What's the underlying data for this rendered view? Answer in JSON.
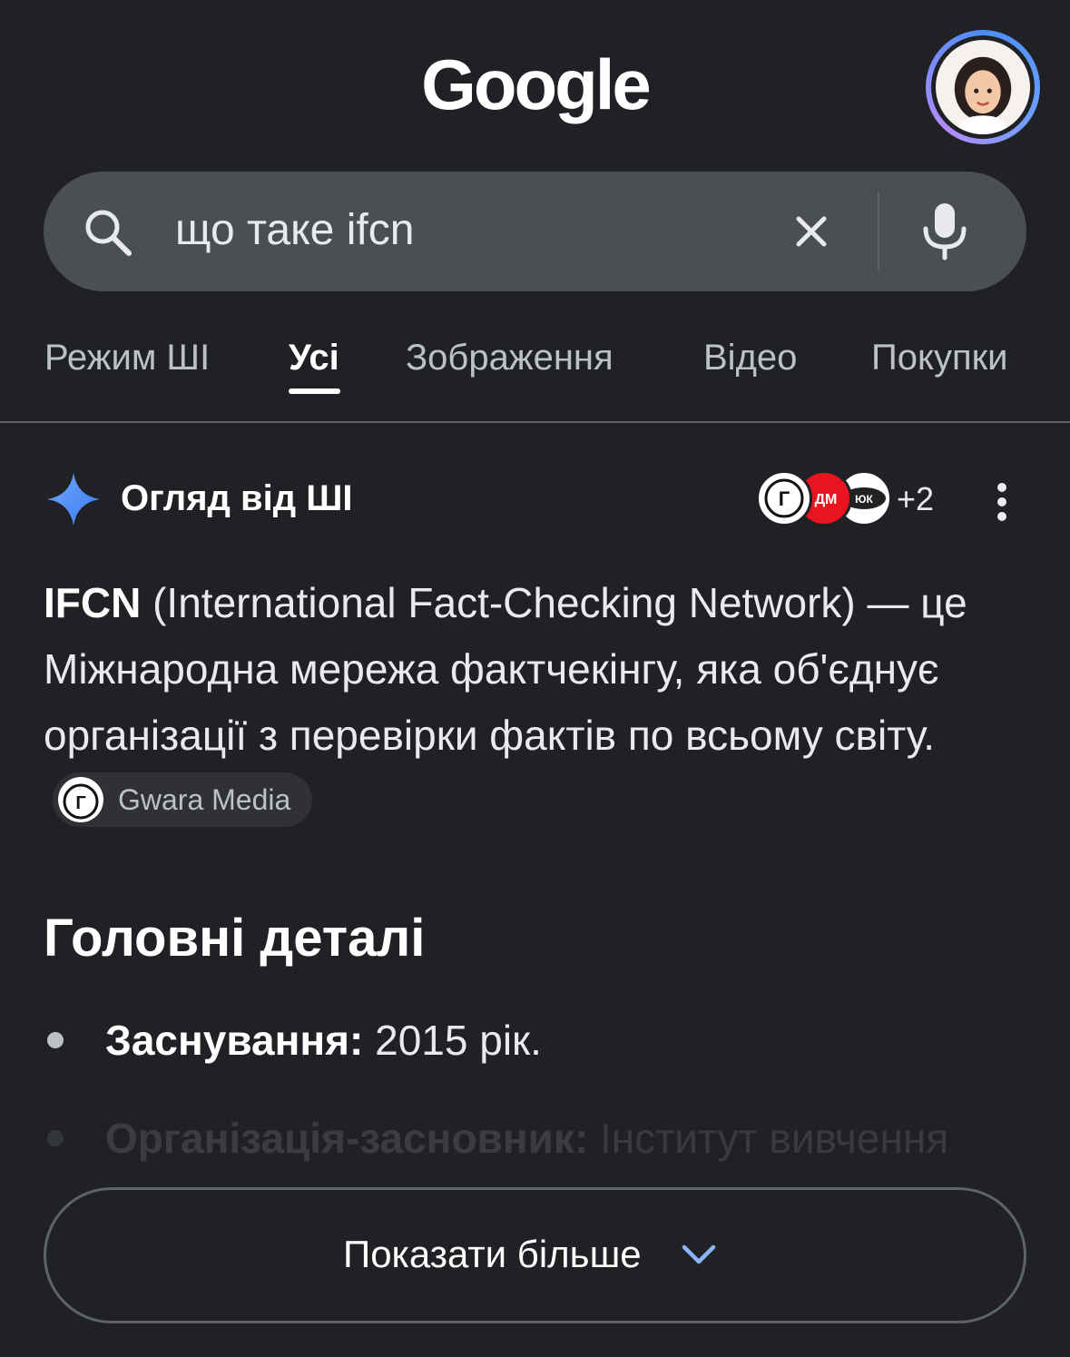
{
  "header": {
    "logo": "Google",
    "avatar_ring_colors": [
      "#4c8df6",
      "#b58bff"
    ]
  },
  "search": {
    "query": "що таке ifcn",
    "icons": [
      "search-icon",
      "clear-icon",
      "mic-icon"
    ]
  },
  "tabs": [
    {
      "label": "Режим ШІ",
      "active": false
    },
    {
      "label": "Усі",
      "active": true
    },
    {
      "label": "Зображення",
      "active": false
    },
    {
      "label": "Відео",
      "active": false
    },
    {
      "label": "Покупки",
      "active": false
    }
  ],
  "ai_overview": {
    "title": "Огляд від ШІ",
    "source_badge_texts": [
      "Г",
      "ДМ",
      "ЮК"
    ],
    "sources_extra": "+2",
    "summary": {
      "term": "IFCN",
      "text_after_term": " (International Fact-Checking Network) — це Міжнародна мережа фактчекінгу, яка об'єднує організації з перевірки фактів по всьому світу.",
      "source_chip": "Gwara Media"
    },
    "key_details_title": "Головні деталі",
    "details": [
      {
        "label": "Заснування:",
        "value": " 2015 рік."
      },
      {
        "label": "Організація-засновник:",
        "value": " Інститут вивчення"
      }
    ],
    "show_more_label": "Показати більше"
  },
  "colors": {
    "background": "#1f2125",
    "search_bg": "#4b4e53",
    "sparkle": "#4c8df6",
    "badge_red": "#e8141f"
  }
}
